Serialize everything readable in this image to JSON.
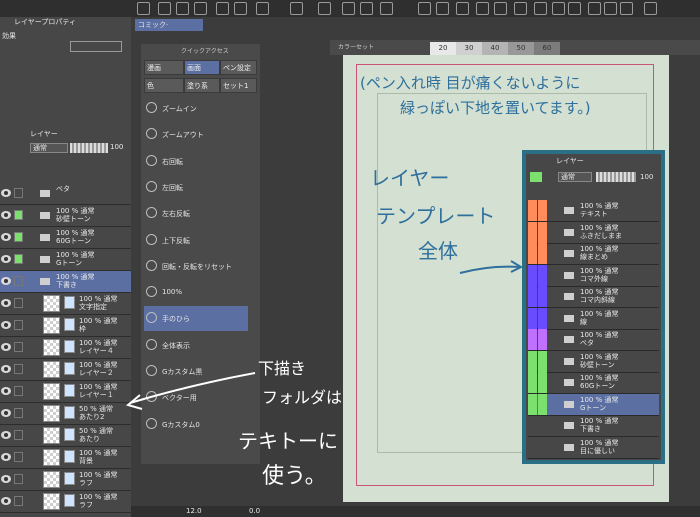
{
  "topbar": {
    "layer_property_tab": "レイヤープロパティ",
    "effect_label": "効果",
    "canvas_tab": "コミック·"
  },
  "layer_panel": {
    "tab": "レイヤー",
    "blend_mode": "通常",
    "opacity": "100",
    "rows": [
      {
        "label": "ベタ",
        "kind": "folder"
      },
      {
        "label": "100 % 通常\n砂壁トーン",
        "kind": "folder"
      },
      {
        "label": "100 % 通常\n60Gトーン",
        "kind": "folder"
      },
      {
        "label": "100 % 通常\nGトーン",
        "kind": "folder"
      },
      {
        "label": "100 % 通常\n下書き",
        "kind": "folder-open"
      },
      {
        "label": "100 % 通常\n文字指定",
        "kind": "layer"
      },
      {
        "label": "100 % 通常\n枠",
        "kind": "layer"
      },
      {
        "label": "100 % 通常\nレイヤー４",
        "kind": "layer"
      },
      {
        "label": "100 % 通常\nレイヤー２",
        "kind": "layer"
      },
      {
        "label": "100 % 通常\nレイヤー１",
        "kind": "layer"
      },
      {
        "label": "50 % 通常\nあたり2",
        "kind": "layer"
      },
      {
        "label": "50 % 通常\nあたり",
        "kind": "layer"
      },
      {
        "label": "100 % 通常\n背景",
        "kind": "layer"
      },
      {
        "label": "100 % 通常\nラフ",
        "kind": "layer"
      },
      {
        "label": "100 % 通常\nラフ",
        "kind": "layer"
      }
    ]
  },
  "quick_access": {
    "title": "クイックアクセス",
    "buttons": [
      "漫画",
      "画面",
      "ペン設定",
      "色",
      "塗り系",
      "セット1"
    ],
    "items": [
      "ズームイン",
      "ズームアウト",
      "右回転",
      "左回転",
      "左右反転",
      "上下反転",
      "回転・反転をリセット",
      "100%",
      "手のひら",
      "全体表示",
      "Gカスタム黒",
      "ベクター用",
      "Gカスタム0"
    ]
  },
  "color_set": {
    "title": "カラーセット",
    "swatches": [
      "20",
      "30",
      "40",
      "50",
      "60"
    ]
  },
  "inset_layer_panel": {
    "tab": "レイヤー",
    "blend_mode": "通常",
    "opacity": "100",
    "rows": [
      {
        "label": "100 % 通常\nテキスト",
        "color": "#ff8c5a"
      },
      {
        "label": "100 % 通常\nふきだしまま",
        "color": "#ff8c5a"
      },
      {
        "label": "100 % 通常\n線まとめ",
        "color": "#ff8c5a"
      },
      {
        "label": "100 % 通常\nコマ外線",
        "color": "#6a4cff"
      },
      {
        "label": "100 % 通常\nコマ内斜線",
        "color": "#6a4cff"
      },
      {
        "label": "100 % 通常\n線",
        "color": "#6a4cff"
      },
      {
        "label": "100 % 通常\nベタ",
        "color": "#c070ff"
      },
      {
        "label": "100 % 通常\n砂壁トーン",
        "color": "#7ce06e"
      },
      {
        "label": "100 % 通常\n60Gトーン",
        "color": "#7ce06e"
      },
      {
        "label": "100 % 通常\nGトーン",
        "color": "#7ce06e"
      },
      {
        "label": "100 % 通常\n下書き",
        "color": ""
      },
      {
        "label": "100 % 通常\n目に優しい",
        "color": ""
      }
    ]
  },
  "annotations": {
    "top_line1": "(ペン入れ時 目が痛くないように",
    "top_line2": "緑っぽい下地を置いてます。)",
    "middle_line1": "レイヤー",
    "middle_line2": "テンプレート",
    "middle_line3": "全体",
    "bottom_line1": "下描き",
    "bottom_line2": "フォルダは",
    "bottom_line3": "テキトーに",
    "bottom_line4": "使う。"
  },
  "statusbar": {
    "zoom": "12.0",
    "angle": "0.0"
  },
  "colors": {
    "canvas_bg": "#d3e0d2",
    "accent_frame": "#2a6f86",
    "pen": "#2e6f9c",
    "selected": "#5b6fa3"
  }
}
